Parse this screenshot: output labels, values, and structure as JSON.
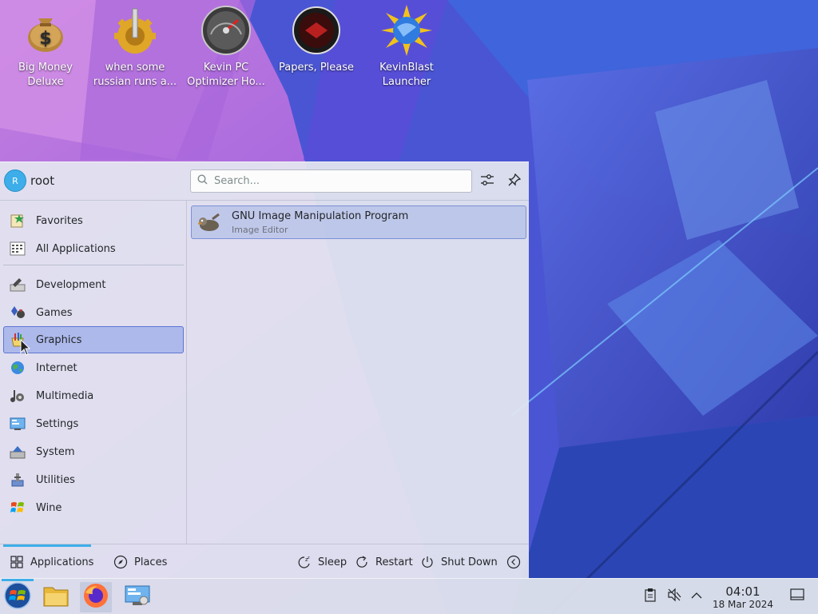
{
  "desktop": {
    "icons": [
      {
        "label": "Big Money\nDeluxe",
        "icon": "money-bag-icon"
      },
      {
        "label": "when some\nrussian runs a...",
        "icon": "gear-icon"
      },
      {
        "label": "Kevin PC\nOptimizer Ho...",
        "icon": "speedometer-icon"
      },
      {
        "label": "Papers, Please",
        "icon": "papers-please-icon"
      },
      {
        "label": "KevinBlast\nLauncher",
        "icon": "globe-burst-icon"
      }
    ]
  },
  "launcher": {
    "user": {
      "initial": "R",
      "name": "root"
    },
    "search": {
      "placeholder": "Search..."
    },
    "categories": [
      {
        "label": "Favorites",
        "icon": "favorites-icon"
      },
      {
        "label": "All Applications",
        "icon": "all-applications-icon"
      },
      {
        "label": "Development",
        "icon": "development-icon"
      },
      {
        "label": "Games",
        "icon": "games-icon"
      },
      {
        "label": "Graphics",
        "icon": "graphics-icon",
        "selected": true
      },
      {
        "label": "Internet",
        "icon": "internet-icon"
      },
      {
        "label": "Multimedia",
        "icon": "multimedia-icon"
      },
      {
        "label": "Settings",
        "icon": "settings-icon"
      },
      {
        "label": "System",
        "icon": "system-icon"
      },
      {
        "label": "Utilities",
        "icon": "utilities-icon"
      },
      {
        "label": "Wine",
        "icon": "wine-icon"
      }
    ],
    "apps": [
      {
        "name": "GNU Image Manipulation Program",
        "description": "Image Editor",
        "icon": "gimp-icon"
      }
    ],
    "footer": {
      "applications": "Applications",
      "places": "Places",
      "sleep": "Sleep",
      "restart": "Restart",
      "shutdown": "Shut Down"
    }
  },
  "taskbar": {
    "clock": {
      "time": "04:01",
      "date": "18 Mar 2024"
    }
  },
  "colors": {
    "accent": "#3daee9",
    "selection": "#6e8ce6"
  }
}
